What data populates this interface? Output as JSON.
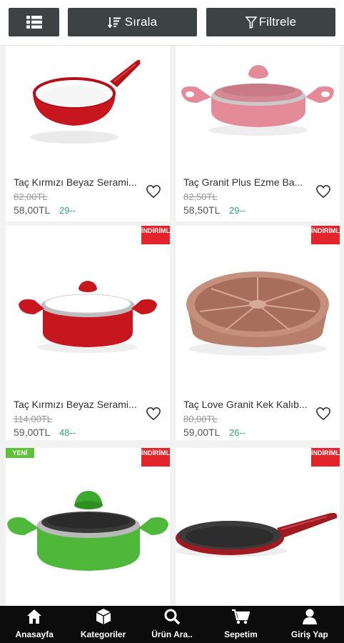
{
  "toolbar": {
    "sort_label": "Sırala",
    "filter_label": "Filtrele"
  },
  "products": [
    {
      "name": "Taç Kırmızı Beyaz Serami...",
      "old_price": "82,00TL",
      "price": "58,00TL",
      "installment": "29--",
      "badge_sale": "",
      "badge_new": ""
    },
    {
      "name": "Taç Granit Plus Ezme Ba...",
      "old_price": "82,50TL",
      "price": "58,50TL",
      "installment": "29--",
      "badge_sale": "",
      "badge_new": ""
    },
    {
      "name": "Taç Kırmızı Beyaz Serami...",
      "old_price": "114,00TL",
      "price": "59,00TL",
      "installment": "48--",
      "badge_sale": "İNDİRİMLİ",
      "badge_new": ""
    },
    {
      "name": "Taç Love Granit Kek Kalıb...",
      "old_price": "80,00TL",
      "price": "59,00TL",
      "installment": "26--",
      "badge_sale": "İNDİRİMLİ",
      "badge_new": ""
    },
    {
      "name": "",
      "old_price": "",
      "price": "",
      "installment": "",
      "badge_sale": "İNDİRİMLİ",
      "badge_new": "YENİ"
    },
    {
      "name": "",
      "old_price": "",
      "price": "",
      "installment": "",
      "badge_sale": "İNDİRİMLİ",
      "badge_new": ""
    }
  ],
  "nav": {
    "home": "Anasayfa",
    "categories": "Kategoriler",
    "search": "Ürün Ara..",
    "cart": "Sepetim",
    "login": "Giriş Yap"
  },
  "colors": {
    "toolbar_button": "#3d4245",
    "sale_badge": "#e3252b",
    "new_badge": "#5ec13a",
    "installment": "#2fa47a",
    "bottom_nav": "#0c0c0c"
  }
}
